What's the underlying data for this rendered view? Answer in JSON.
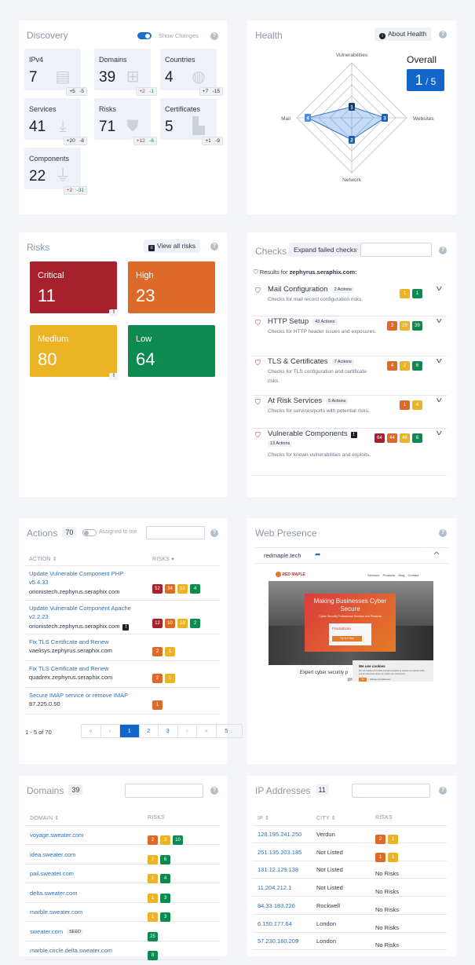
{
  "discovery": {
    "title": "Discovery",
    "show_changes_label": "Show Changes",
    "show_changes_on": true,
    "tiles": [
      {
        "label": "IPv4",
        "value": "7",
        "icon": "id-card-icon",
        "glyph": "▤",
        "plus": "+5",
        "minus": "-5",
        "colored": false
      },
      {
        "label": "Domains",
        "value": "39",
        "icon": "sitemap-icon",
        "glyph": "⊞",
        "plus": "+2",
        "minus": "-1",
        "colored": true
      },
      {
        "label": "Countries",
        "value": "4",
        "icon": "globe-icon",
        "glyph": "◍",
        "plus": "+7",
        "minus": "-15",
        "colored": false
      },
      {
        "label": "Services",
        "value": "41",
        "icon": "download-tray-icon",
        "glyph": "⤓",
        "plus": "+20",
        "minus": "-8",
        "colored": false
      },
      {
        "label": "Risks",
        "value": "71",
        "icon": "shield-alert-icon",
        "glyph": "⛊",
        "plus": "+12",
        "minus": "-6",
        "colored": true
      },
      {
        "label": "Certificates",
        "value": "5",
        "icon": "certificate-icon",
        "glyph": "▙",
        "plus": "+1",
        "minus": "-9",
        "colored": false
      },
      {
        "label": "Components",
        "value": "22",
        "icon": "plug-icon",
        "glyph": "⏚",
        "plus": "+2",
        "minus": "-31",
        "colored": true
      }
    ]
  },
  "health": {
    "title": "Health",
    "about_label": "About Health",
    "overall_label": "Overall",
    "overall_score": "1",
    "overall_max": "5",
    "chart_data": {
      "type": "radar",
      "axes": [
        "Vulnerabilities",
        "Websites",
        "Network",
        "Mail"
      ],
      "values": [
        1,
        3,
        2,
        4
      ],
      "range": [
        0,
        5
      ],
      "levels": 5,
      "grid": true
    }
  },
  "risks": {
    "title": "Risks",
    "view_all_label": "View all risks",
    "tiles": [
      {
        "label": "Critical",
        "value": "11",
        "severity": "critical",
        "flag": true
      },
      {
        "label": "High",
        "value": "23",
        "severity": "high",
        "flag": false
      },
      {
        "label": "Medium",
        "value": "80",
        "severity": "medium",
        "flag": true
      },
      {
        "label": "Low",
        "value": "64",
        "severity": "low",
        "flag": false
      }
    ]
  },
  "colors": {
    "critical": "#a7202d",
    "high": "#de6a2a",
    "medium": "#ecb324",
    "low": "#0c8a50",
    "accent": "#1167c9"
  },
  "checks": {
    "title": "Checks",
    "expand_label": "Expand failed checks",
    "search_value": "",
    "results_for_label": "Results for",
    "results_domain": "zephyrus.seraphix.com:",
    "items": [
      {
        "title": "Mail Configuration",
        "actions": "2 Actions",
        "desc": "Checks for mail record configuration risks.",
        "flag": false,
        "badges": [
          {
            "sev": "medium",
            "v": "1"
          },
          {
            "sev": "low",
            "v": "1"
          }
        ]
      },
      {
        "title": "HTTP Setup",
        "actions": "43 Actions",
        "desc": "Checks for HTTP header issues and exposures.",
        "flag": false,
        "badges": [
          {
            "sev": "high",
            "v": "3"
          },
          {
            "sev": "medium",
            "v": "29"
          },
          {
            "sev": "low",
            "v": "39"
          }
        ]
      },
      {
        "title": "TLS & Certificates",
        "actions": "7 Actions",
        "desc": "Checks for TLS configuration and certificate risks.",
        "flag": false,
        "badges": [
          {
            "sev": "high",
            "v": "4"
          },
          {
            "sev": "medium",
            "v": "2"
          },
          {
            "sev": "low",
            "v": "6"
          }
        ]
      },
      {
        "title": "At Risk Services",
        "actions": "5 Actions",
        "desc": "Checks for services/ports with potential risks.",
        "flag": false,
        "badges": [
          {
            "sev": "high",
            "v": "1"
          },
          {
            "sev": "medium",
            "v": "4"
          }
        ]
      },
      {
        "title": "Vulnerable Components",
        "actions": "13 Actions",
        "desc": "Checks for known vulnerabilities and exploits.",
        "flag": true,
        "badges": [
          {
            "sev": "critical",
            "v": "64"
          },
          {
            "sev": "high",
            "v": "44"
          },
          {
            "sev": "medium",
            "v": "46"
          },
          {
            "sev": "low",
            "v": "6"
          }
        ]
      }
    ]
  },
  "actions": {
    "title": "Actions",
    "count": "70",
    "assigned_label": "Assigned to me",
    "assigned_on": false,
    "search_value": "",
    "col_action": "ACTION",
    "col_risks": "RISKS",
    "rows": [
      {
        "title": "Update Vulnerable Component PHP v5.4.33",
        "host": "orionistech.zephyrus.seraphix.com",
        "flag": false,
        "badges": [
          {
            "sev": "critical",
            "v": "52"
          },
          {
            "sev": "high",
            "v": "34"
          },
          {
            "sev": "medium",
            "v": "10"
          },
          {
            "sev": "low",
            "v": "4"
          }
        ]
      },
      {
        "title": "Update Vulnerable Component Apache v2.2.23",
        "host": "orionistech.zephyrus.seraphix.com",
        "flag": true,
        "badges": [
          {
            "sev": "critical",
            "v": "12"
          },
          {
            "sev": "high",
            "v": "10"
          },
          {
            "sev": "medium",
            "v": "18"
          },
          {
            "sev": "low",
            "v": "2"
          }
        ]
      },
      {
        "title": "Fix TLS Certificate and Renew",
        "host": "vaelisys.zephyrus.seraphix.com",
        "flag": false,
        "badges": [
          {
            "sev": "high",
            "v": "2"
          },
          {
            "sev": "medium",
            "v": "1"
          }
        ]
      },
      {
        "title": "Fix TLS Certificate and Renew",
        "host": "quadrex.zephyrus.seraphix.com",
        "flag": false,
        "badges": [
          {
            "sev": "high",
            "v": "2"
          },
          {
            "sev": "medium",
            "v": "1"
          }
        ]
      },
      {
        "title": "Secure IMAP service or remove IMAP",
        "host": "87.225.0.50",
        "flag": false,
        "badges": [
          {
            "sev": "high",
            "v": "1"
          }
        ]
      }
    ],
    "range_label": "1 - 5 of 70",
    "pager": {
      "first": "«",
      "prev": "‹",
      "pages": [
        "1",
        "2",
        "3"
      ],
      "current": "1",
      "next": "›",
      "last": "»",
      "page_size": "5"
    }
  },
  "web_presence": {
    "title": "Web Presence",
    "site": "redmaple.tech",
    "preview": {
      "brand": "RED MAPLE",
      "brand_sub": "TECHNOLOGIES",
      "nav": [
        "Services",
        "Products",
        "Blog",
        "Contact"
      ],
      "hero_title": "Making Businesses Cyber Secure",
      "hero_sub": "Cyber Security Professional Services and Products",
      "product": "FractalScan",
      "product_sub": "Surface",
      "cta": "Try for Free",
      "tagline": "Expert cyber security p",
      "tagline2": "prod",
      "cookie_title": "We use cookies",
      "cookie_text": "We use cookies and similar (Google Analytics) to analyse our website traffic, and to understand where our visitors are coming from.",
      "cookie_ok": "OK",
      "cookie_pref": "Change my preferences"
    }
  },
  "domains": {
    "title": "Domains",
    "count": "39",
    "search_value": "",
    "col_domain": "DOMAIN",
    "col_risks": "RISKS",
    "rows": [
      {
        "name": "voyage.sweater.com",
        "seed": false,
        "badges": [
          {
            "sev": "high",
            "v": "2"
          },
          {
            "sev": "medium",
            "v": "3"
          },
          {
            "sev": "low",
            "v": "10"
          }
        ]
      },
      {
        "name": "idea.sweater.com",
        "seed": false,
        "badges": [
          {
            "sev": "medium",
            "v": "2"
          },
          {
            "sev": "low",
            "v": "6"
          }
        ]
      },
      {
        "name": "pail.sweater.com",
        "seed": false,
        "badges": [
          {
            "sev": "medium",
            "v": "1"
          },
          {
            "sev": "low",
            "v": "4"
          }
        ]
      },
      {
        "name": "delta.sweater.com",
        "seed": false,
        "badges": [
          {
            "sev": "medium",
            "v": "1"
          },
          {
            "sev": "low",
            "v": "3"
          }
        ]
      },
      {
        "name": "marble.sweater.com",
        "seed": false,
        "badges": [
          {
            "sev": "medium",
            "v": "1"
          },
          {
            "sev": "low",
            "v": "3"
          }
        ]
      },
      {
        "name": "sweater.com",
        "seed": true,
        "badges": [
          {
            "sev": "low",
            "v": "25"
          }
        ]
      },
      {
        "name": "marble.circle.delta.sweater.com",
        "seed": false,
        "badges": [
          {
            "sev": "low",
            "v": "8"
          }
        ]
      }
    ],
    "seed_label": "SEED"
  },
  "ip_addresses": {
    "title": "IP Addresses",
    "count": "11",
    "search_value": "",
    "col_ip": "IP",
    "col_city": "CITY",
    "col_risks": "RISKS",
    "no_risks_label": "No Risks",
    "rows": [
      {
        "ip": "128.195.241.250",
        "city": "Verdun",
        "badges": [
          {
            "sev": "high",
            "v": "2"
          },
          {
            "sev": "medium",
            "v": "1"
          }
        ]
      },
      {
        "ip": "251.135.203.185",
        "city": "Not Listed",
        "badges": [
          {
            "sev": "high",
            "v": "1"
          },
          {
            "sev": "medium",
            "v": "1"
          }
        ]
      },
      {
        "ip": "131.12.129.138",
        "city": "Not Listed",
        "badges": []
      },
      {
        "ip": "11.204.212.1",
        "city": "Not Listed",
        "badges": []
      },
      {
        "ip": "84.33.183.226",
        "city": "Rockwell",
        "badges": []
      },
      {
        "ip": "6.150.177.64",
        "city": "London",
        "badges": []
      },
      {
        "ip": "57.230.160.209",
        "city": "London",
        "badges": []
      }
    ]
  }
}
